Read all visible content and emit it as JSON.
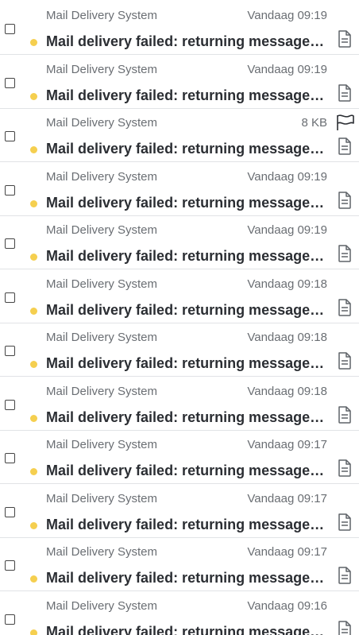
{
  "messages": [
    {
      "sender": "Mail Delivery System",
      "meta": "Vandaag 09:19",
      "subject": "Mail delivery failed: returning message to sender",
      "flagged": false,
      "icon": "document-icon"
    },
    {
      "sender": "Mail Delivery System",
      "meta": "Vandaag 09:19",
      "subject": "Mail delivery failed: returning message to sender",
      "flagged": false,
      "icon": "document-icon"
    },
    {
      "sender": "Mail Delivery System",
      "meta": "8 KB",
      "subject": "Mail delivery failed: returning message to sender",
      "flagged": true,
      "icon": "document-icon"
    },
    {
      "sender": "Mail Delivery System",
      "meta": "Vandaag 09:19",
      "subject": "Mail delivery failed: returning message to sender",
      "flagged": false,
      "icon": "document-icon"
    },
    {
      "sender": "Mail Delivery System",
      "meta": "Vandaag 09:19",
      "subject": "Mail delivery failed: returning message to sender",
      "flagged": false,
      "icon": "document-icon"
    },
    {
      "sender": "Mail Delivery System",
      "meta": "Vandaag 09:18",
      "subject": "Mail delivery failed: returning message to sender",
      "flagged": false,
      "icon": "document-icon"
    },
    {
      "sender": "Mail Delivery System",
      "meta": "Vandaag 09:18",
      "subject": "Mail delivery failed: returning message to sender",
      "flagged": false,
      "icon": "document-icon"
    },
    {
      "sender": "Mail Delivery System",
      "meta": "Vandaag 09:18",
      "subject": "Mail delivery failed: returning message to sender",
      "flagged": false,
      "icon": "document-icon"
    },
    {
      "sender": "Mail Delivery System",
      "meta": "Vandaag 09:17",
      "subject": "Mail delivery failed: returning message to sender",
      "flagged": false,
      "icon": "document-icon"
    },
    {
      "sender": "Mail Delivery System",
      "meta": "Vandaag 09:17",
      "subject": "Mail delivery failed: returning message to sender",
      "flagged": false,
      "icon": "document-icon"
    },
    {
      "sender": "Mail Delivery System",
      "meta": "Vandaag 09:17",
      "subject": "Mail delivery failed: returning message to sender",
      "flagged": false,
      "icon": "document-icon"
    },
    {
      "sender": "Mail Delivery System",
      "meta": "Vandaag 09:16",
      "subject": "Mail delivery failed: returning message to sender",
      "flagged": false,
      "icon": "document-icon"
    }
  ],
  "colors": {
    "unread_dot": "#f5cf4f",
    "subject": "#2b2e33",
    "muted": "#6a6e73",
    "divider": "#e1e3e6"
  }
}
